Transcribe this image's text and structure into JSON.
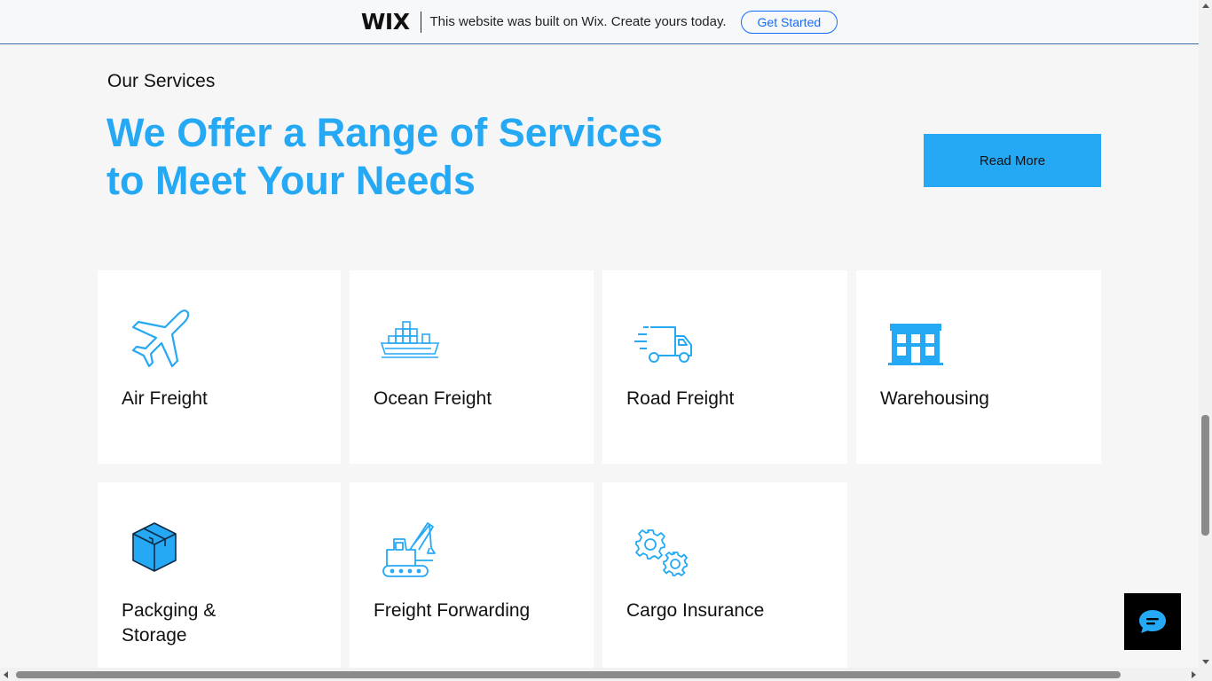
{
  "wix_banner": {
    "logo": "WIX",
    "message": "This website was built on Wix. Create yours today.",
    "cta_label": "Get Started"
  },
  "services": {
    "eyebrow": "Our Services",
    "headline_line1": "We Offer a Range of Services",
    "headline_line2": "to Meet Your Needs",
    "read_more_label": "Read More",
    "accent_color": "#26a9f5",
    "items": [
      {
        "label": "Air Freight",
        "icon": "airplane-icon"
      },
      {
        "label": "Ocean Freight",
        "icon": "cargo-ship-icon"
      },
      {
        "label": "Road Freight",
        "icon": "delivery-truck-icon"
      },
      {
        "label": "Warehousing",
        "icon": "warehouse-building-icon"
      },
      {
        "label_line1": "Packging &",
        "label_line2": "Storage",
        "icon": "package-box-icon"
      },
      {
        "label": "Freight Forwarding",
        "icon": "crane-icon"
      },
      {
        "label": "Cargo Insurance",
        "icon": "gears-icon"
      }
    ]
  },
  "chat": {
    "icon": "chat-bubble-icon"
  }
}
